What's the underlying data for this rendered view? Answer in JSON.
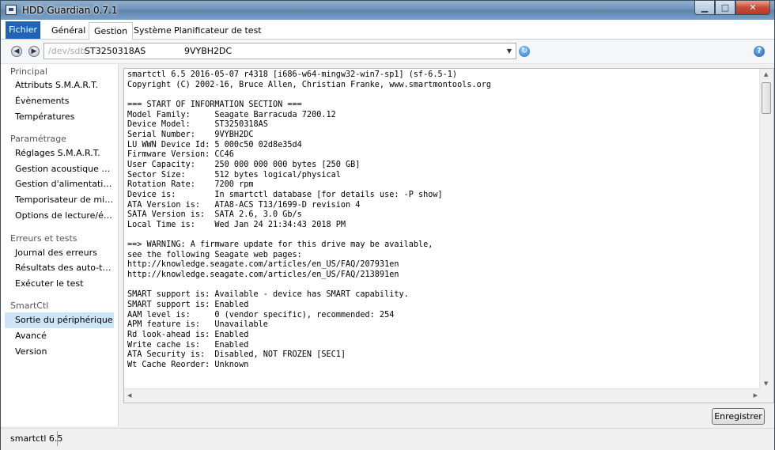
{
  "window": {
    "title": "HDD Guardian 0.7.1",
    "min": "▁",
    "max": "□",
    "close": "✕"
  },
  "ribbon": {
    "tabs": [
      "Fichier",
      "Général",
      "Gestion",
      "Système",
      "Planificateur de test"
    ],
    "selected": "Gestion"
  },
  "toolbar": {
    "device_path": "/dev/sdb",
    "model": "ST3250318AS",
    "serial": "9VYBH2DC",
    "back_icon": "arrow-left-icon",
    "forward_icon": "arrow-right-icon",
    "refresh_icon": "refresh-icon",
    "help_icon": "help-icon",
    "help_glyph": "?"
  },
  "sidebar": {
    "groups": [
      {
        "title": "Principal",
        "items": [
          "Attributs S.M.A.R.T.",
          "Évènements",
          "Températures"
        ]
      },
      {
        "title": "Paramétrage",
        "items": [
          "Réglages S.M.A.R.T.",
          "Gestion acoustique avancée",
          "Gestion d'alimentation avancée",
          "Temporisateur de mise en veille",
          "Options de lecture/écriture"
        ]
      },
      {
        "title": "Erreurs et tests",
        "items": [
          "Journal des erreurs",
          "Résultats des auto-tests",
          "Exécuter le test"
        ]
      },
      {
        "title": "SmartCtl",
        "items": [
          "Sortie du périphérique",
          "Avancé",
          "Version"
        ]
      }
    ],
    "selected": "Sortie du périphérique"
  },
  "output": {
    "lines": [
      "smartctl 6.5 2016-05-07 r4318 [i686-w64-mingw32-win7-sp1] (sf-6.5-1)",
      "Copyright (C) 2002-16, Bruce Allen, Christian Franke, www.smartmontools.org",
      "",
      "=== START OF INFORMATION SECTION ===",
      "Model Family:     Seagate Barracuda 7200.12",
      "Device Model:     ST3250318AS",
      "Serial Number:    9VYBH2DC",
      "LU WWN Device Id: 5 000c50 02d8e35d4",
      "Firmware Version: CC46",
      "User Capacity:    250 000 000 000 bytes [250 GB]",
      "Sector Size:      512 bytes logical/physical",
      "Rotation Rate:    7200 rpm",
      "Device is:        In smartctl database [for details use: -P show]",
      "ATA Version is:   ATA8-ACS T13/1699-D revision 4",
      "SATA Version is:  SATA 2.6, 3.0 Gb/s",
      "Local Time is:    Wed Jan 24 21:34:43 2018 PM",
      "",
      "==> WARNING: A firmware update for this drive may be available,",
      "see the following Seagate web pages:",
      "http://knowledge.seagate.com/articles/en_US/FAQ/207931en",
      "http://knowledge.seagate.com/articles/en_US/FAQ/213891en",
      "",
      "SMART support is: Available - device has SMART capability.",
      "SMART support is: Enabled",
      "AAM level is:     0 (vendor specific), recommended: 254",
      "APM feature is:   Unavailable",
      "Rd look-ahead is: Enabled",
      "Write cache is:   Enabled",
      "ATA Security is:  Disabled, NOT FROZEN [SEC1]",
      "Wt Cache Reorder: Unknown"
    ]
  },
  "save_button": "Enregistrer",
  "status": {
    "text": "smartctl 6.5"
  }
}
